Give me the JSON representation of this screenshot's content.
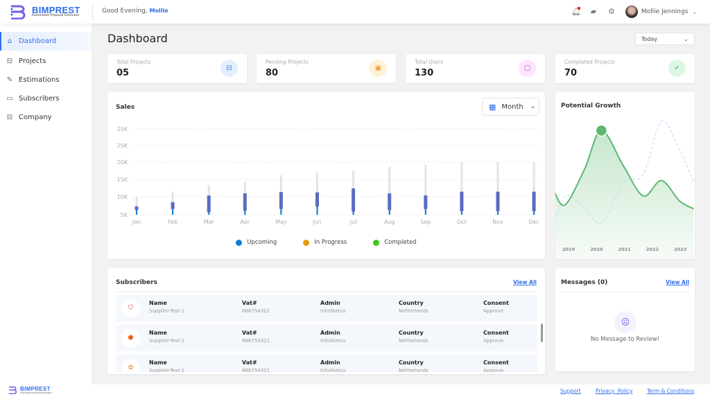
{
  "brand": {
    "name": "BIMPREST",
    "tagline": "Automated Proposal Estimator"
  },
  "header": {
    "greeting": "Good Evening,",
    "user_first": "Mollie",
    "user_name": "Mollie Jennings",
    "icons": [
      "bell-icon",
      "chat-icon",
      "gear-icon"
    ],
    "notification_dot": "#e00000"
  },
  "sidebar": {
    "items": [
      {
        "label": "Dashboard",
        "icon": "home-icon",
        "active": true
      },
      {
        "label": "Projects",
        "icon": "briefcase-icon"
      },
      {
        "label": "Estimations",
        "icon": "edit-icon"
      },
      {
        "label": "Subscribers",
        "icon": "chat-icon"
      },
      {
        "label": "Company",
        "icon": "briefcase-icon"
      }
    ]
  },
  "page": {
    "title": "Dashboard",
    "period": "Today"
  },
  "stats": [
    {
      "label": "Total Projects",
      "value": "05",
      "icon": "briefcase-icon",
      "color": "#3b7cf0",
      "bg": "#e3eeff"
    },
    {
      "label": "Pending Projects",
      "value": "80",
      "icon": "calendar-clock-icon",
      "color": "#f0a030",
      "bg": "#fff1d6"
    },
    {
      "label": "Total Users",
      "value": "130",
      "icon": "users-icon",
      "color": "#d040d0",
      "bg": "#fbe6fb"
    },
    {
      "label": "Completed Projects",
      "value": "70",
      "icon": "check-circle-icon",
      "color": "#3cb060",
      "bg": "#ddf7e4"
    }
  ],
  "sales": {
    "title": "Sales",
    "range": "Month"
  },
  "chart_data": [
    {
      "type": "bar",
      "title": "Sales",
      "subtype": "range-candlestick",
      "categories": [
        "Jan",
        "Feb",
        "Mar",
        "Apr",
        "May",
        "Jun",
        "Jul",
        "Aug",
        "Sep",
        "Oct",
        "Nov",
        "Dec"
      ],
      "ytick_labels": [
        "25K",
        "25K",
        "20K",
        "15K",
        "10K",
        "5K"
      ],
      "ylim": [
        5,
        25
      ],
      "unit": "K",
      "grid": true,
      "legend": "bottom",
      "series": [
        {
          "name": "Upcoming",
          "color": "#0a7fd8"
        },
        {
          "name": "In Progress",
          "color": "#e89a10"
        },
        {
          "name": "Completed",
          "color": "#3cc81e"
        }
      ],
      "high": [
        10.1,
        11.6,
        13.4,
        14.5,
        16.3,
        17.0,
        17.6,
        18.7,
        19.3,
        20.1,
        20.1,
        20.1
      ],
      "range_top": [
        7.4,
        8.6,
        10.5,
        11.1,
        11.5,
        11.4,
        12.5,
        11.1,
        10.5,
        11.6,
        11.6,
        11.6
      ],
      "range_bottom": [
        6.3,
        6.6,
        5.7,
        6.1,
        6.6,
        7.3,
        5.9,
        6.3,
        6.6,
        6.0,
        6.0,
        6.0
      ]
    },
    {
      "type": "line",
      "title": "Potential Growth",
      "x": [
        2018.5,
        2018.9,
        2019.6,
        2020.2,
        2021,
        2021.7,
        2022.35,
        2023,
        2023.5
      ],
      "xtick_labels": [
        "2019",
        "2020",
        "2021",
        "2022",
        "2023"
      ],
      "series": [
        {
          "color": "#5cb86e",
          "style": "solid-filled",
          "values": [
            43,
            32,
            60,
            90,
            62,
            39,
            51,
            35,
            29
          ],
          "highlight_index": 3
        },
        {
          "color": "#c9dcf7",
          "style": "dashed",
          "values": [
            16,
            39,
            30,
            18,
            49,
            56,
            97,
            75,
            50
          ]
        }
      ]
    }
  ],
  "growth": {
    "title": "Potential Growth"
  },
  "subscribers": {
    "title": "Subscribers",
    "view_all": "View All",
    "headers": [
      "Name",
      "Vat#",
      "Admin",
      "Country",
      "Consent"
    ],
    "rows": [
      [
        "Supplier-Test-1",
        "886754321",
        "InfoSketco",
        "Nehterlands",
        "Approve"
      ],
      [
        "Supplier-Test-1",
        "886754321",
        "InfoSketco",
        "Nehterlands",
        "Approve"
      ],
      [
        "Supplier-Test-1",
        "886754321",
        "InfoSketco",
        "Nehterlands",
        "Approve"
      ]
    ]
  },
  "messages": {
    "title": "Messages (0)",
    "view_all": "View All",
    "empty": "No Message to Review!"
  },
  "footer": {
    "links": [
      "Support",
      "Privacy  Policy",
      "Term & Conditions"
    ]
  }
}
